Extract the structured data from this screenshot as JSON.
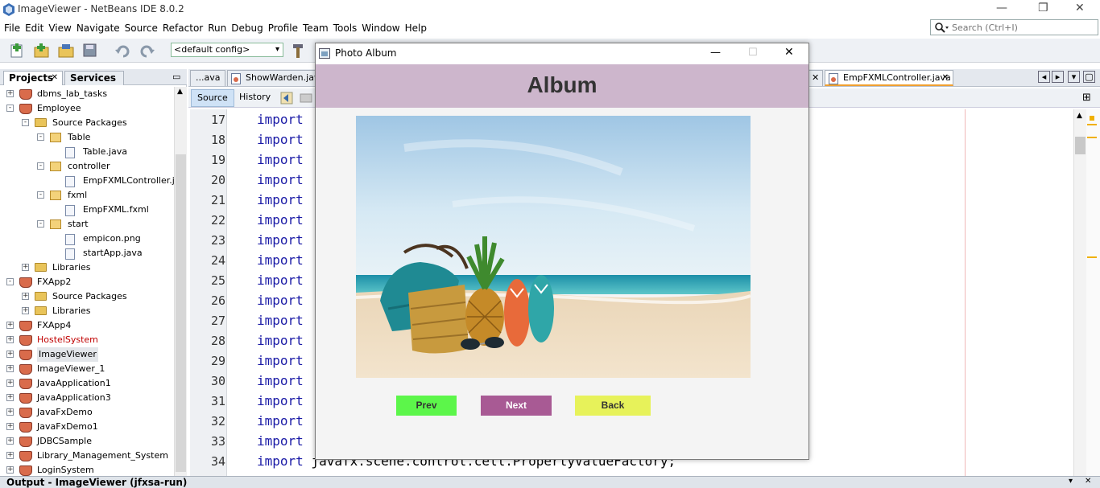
{
  "window": {
    "title": "ImageViewer - NetBeans IDE 8.0.2"
  },
  "menu": [
    "File",
    "Edit",
    "View",
    "Navigate",
    "Source",
    "Refactor",
    "Run",
    "Debug",
    "Profile",
    "Team",
    "Tools",
    "Window",
    "Help"
  ],
  "search": {
    "placeholder": "Search (Ctrl+I)"
  },
  "toolbar": {
    "config": "<default config>"
  },
  "projects_panel": {
    "tabs": [
      "Projects",
      "Services"
    ],
    "tree": [
      {
        "label": "dbms_lab_tasks",
        "icon": "coffee-cup-icon"
      },
      {
        "label": "Employee",
        "icon": "coffee-cup-icon"
      },
      {
        "label": "Source Packages",
        "icon": "folder-icon"
      },
      {
        "label": "Table",
        "icon": "package-icon"
      },
      {
        "label": "Table.java",
        "icon": "java-file-icon"
      },
      {
        "label": "controller",
        "icon": "package-icon"
      },
      {
        "label": "EmpFXMLController.java",
        "icon": "java-file-icon"
      },
      {
        "label": "fxml",
        "icon": "package-icon"
      },
      {
        "label": "EmpFXML.fxml",
        "icon": "fxml-file-icon"
      },
      {
        "label": "start",
        "icon": "package-icon"
      },
      {
        "label": "empicon.png",
        "icon": "image-file-icon"
      },
      {
        "label": "startApp.java",
        "icon": "java-file-icon"
      },
      {
        "label": "Libraries",
        "icon": "folder-icon"
      },
      {
        "label": "FXApp2",
        "icon": "coffee-cup-icon"
      },
      {
        "label": "Source Packages",
        "icon": "folder-icon"
      },
      {
        "label": "Libraries",
        "icon": "folder-icon"
      },
      {
        "label": "FXApp4",
        "icon": "coffee-cup-icon"
      },
      {
        "label": "HostelSystem",
        "icon": "coffee-cup-icon"
      },
      {
        "label": "ImageViewer",
        "icon": "coffee-cup-icon"
      },
      {
        "label": "ImageViewer_1",
        "icon": "coffee-cup-icon"
      },
      {
        "label": "JavaApplication1",
        "icon": "coffee-cup-icon"
      },
      {
        "label": "JavaApplication3",
        "icon": "coffee-cup-icon"
      },
      {
        "label": "JavaFxDemo",
        "icon": "coffee-cup-icon"
      },
      {
        "label": "JavaFxDemo1",
        "icon": "coffee-cup-icon"
      },
      {
        "label": "JDBCSample",
        "icon": "coffee-cup-icon"
      },
      {
        "label": "Library_Management_System",
        "icon": "coffee-cup-icon"
      },
      {
        "label": "LoginSystem",
        "icon": "coffee-cup-icon"
      }
    ]
  },
  "editor": {
    "tabs": [
      "...ava",
      "ShowWarden.java",
      "EmpFXMLController.java"
    ],
    "subtabs": [
      "Source",
      "History"
    ],
    "line_numbers": [
      "17",
      "18",
      "19",
      "20",
      "21",
      "22",
      "23",
      "24",
      "25",
      "26",
      "27",
      "28",
      "29",
      "30",
      "31",
      "32",
      "33",
      "34"
    ],
    "keyword": "import",
    "last_line_rest": " javafx.scene.control.cell.PropertyValueFactory;"
  },
  "output": {
    "title": "Output - ImageViewer (jfxsa-run)"
  },
  "dialog": {
    "title": "Photo Album",
    "header": "Album",
    "buttons": {
      "prev": "Prev",
      "next": "Next",
      "back": "Back"
    }
  },
  "colors": {
    "dialog_header": "#cdb6cc",
    "prev_button": "#5cf64a",
    "next_button": "#a85a94",
    "back_button": "#e7f25a",
    "keyword": "#1a1aa6"
  }
}
